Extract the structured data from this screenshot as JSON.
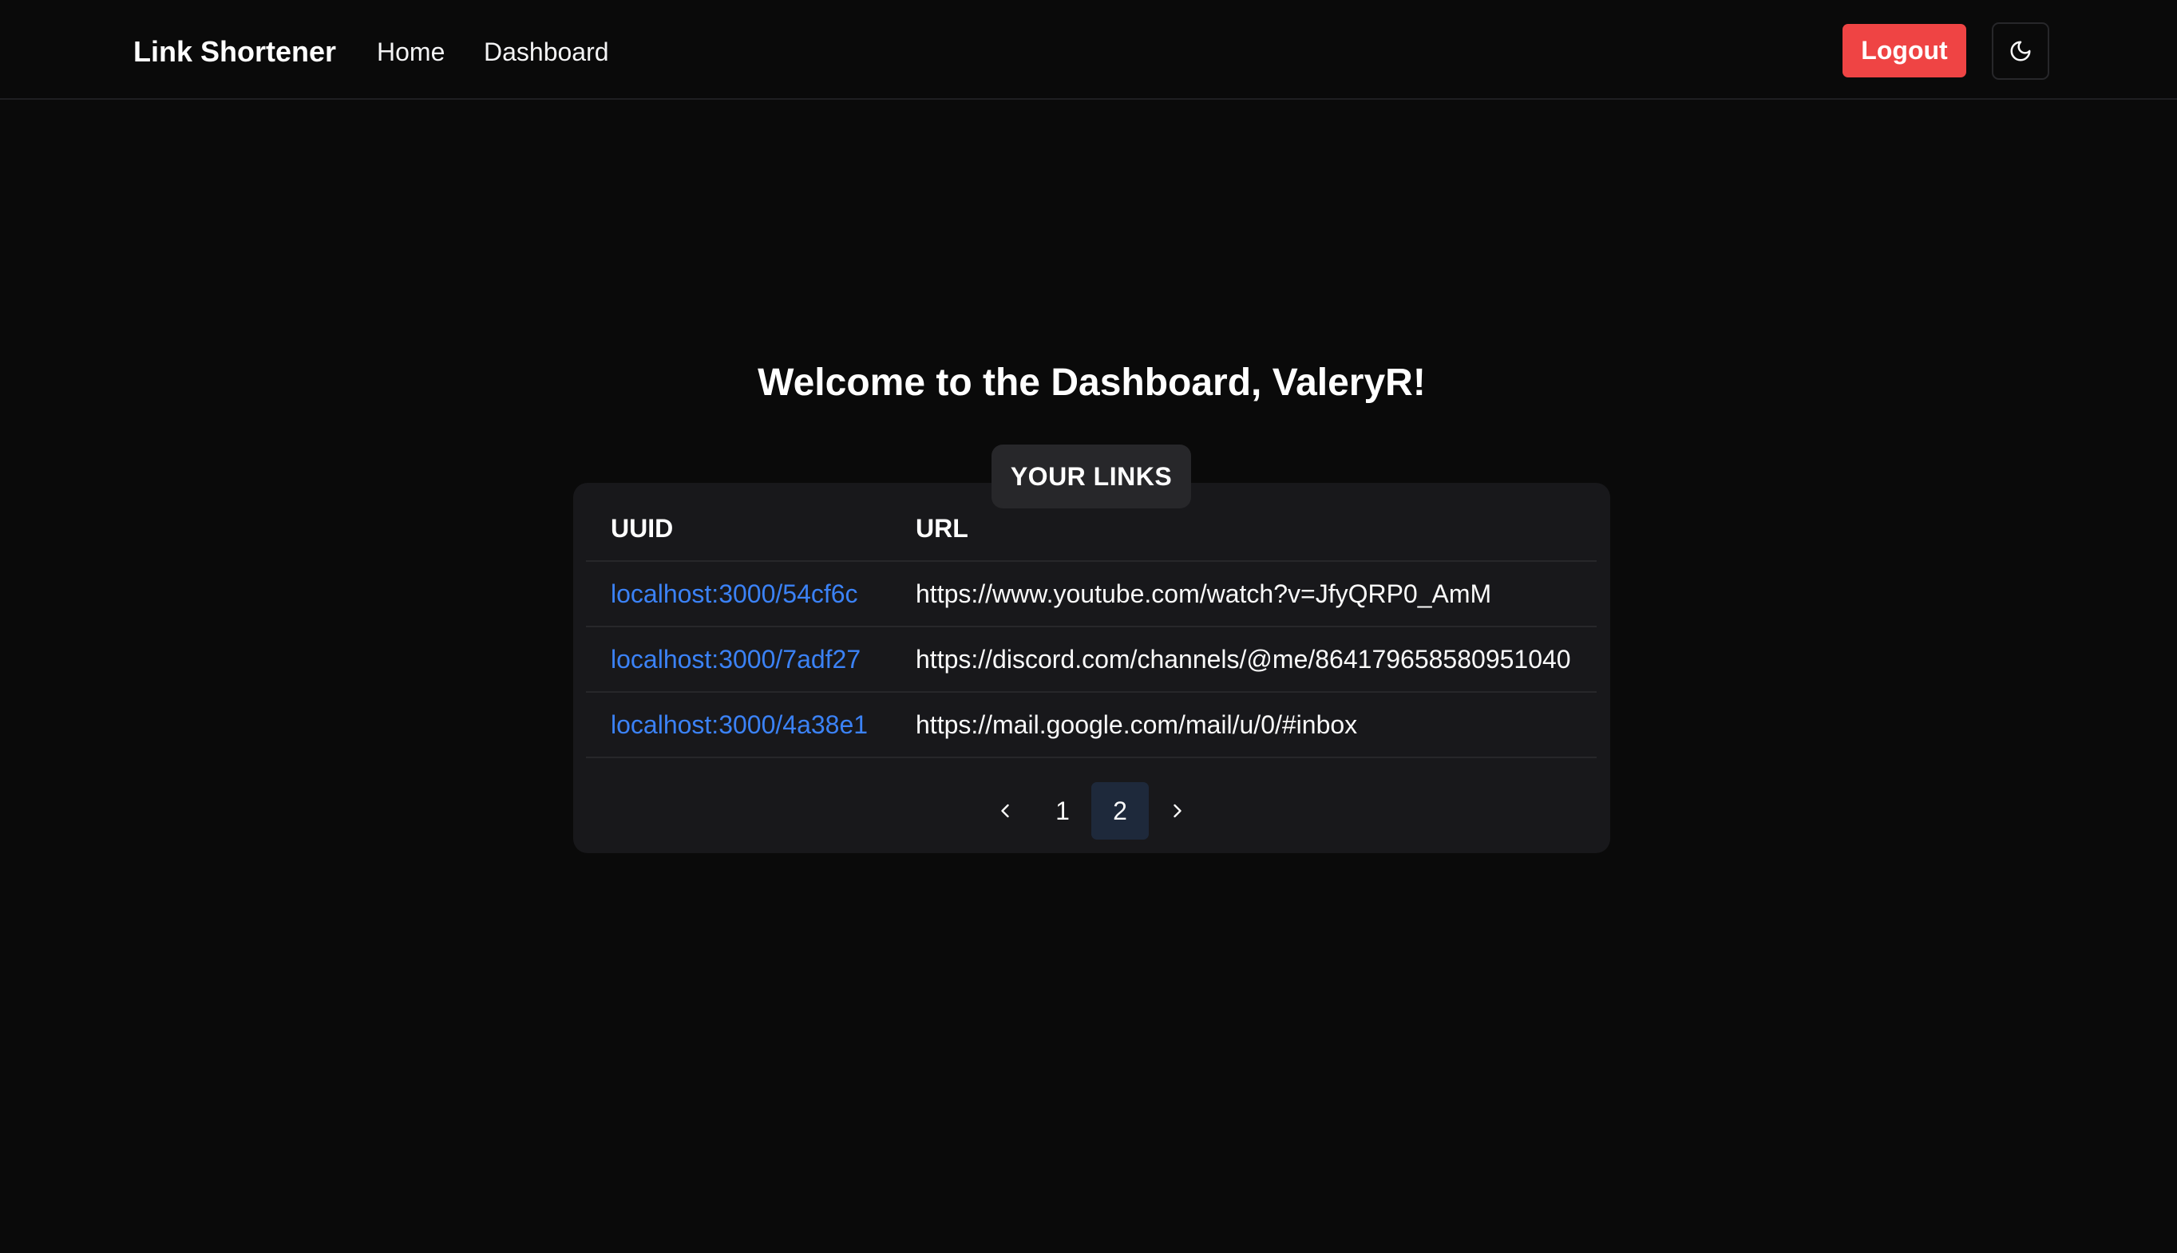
{
  "navbar": {
    "brand": "Link Shortener",
    "links": [
      "Home",
      "Dashboard"
    ],
    "logout_label": "Logout",
    "theme_icon": "moon-icon"
  },
  "main": {
    "welcome": "Welcome to the Dashboard, ValeryR!",
    "card_title": "YOUR LINKS",
    "columns": [
      "UUID",
      "URL"
    ],
    "rows": [
      {
        "uuid": "localhost:3000/54cf6c",
        "url": "https://www.youtube.com/watch?v=JfyQRP0_AmM"
      },
      {
        "uuid": "localhost:3000/7adf27",
        "url": "https://discord.com/channels/@me/864179658580951040"
      },
      {
        "uuid": "localhost:3000/4a38e1",
        "url": "https://mail.google.com/mail/u/0/#inbox"
      }
    ],
    "pagination": {
      "pages": [
        "1",
        "2"
      ],
      "current_page": "2"
    }
  },
  "colors": {
    "background": "#0a0a0a",
    "card": "#18181b",
    "badge": "#27272a",
    "link": "#3b82f6",
    "logout": "#ef4444",
    "active_page": "#1e293b"
  }
}
